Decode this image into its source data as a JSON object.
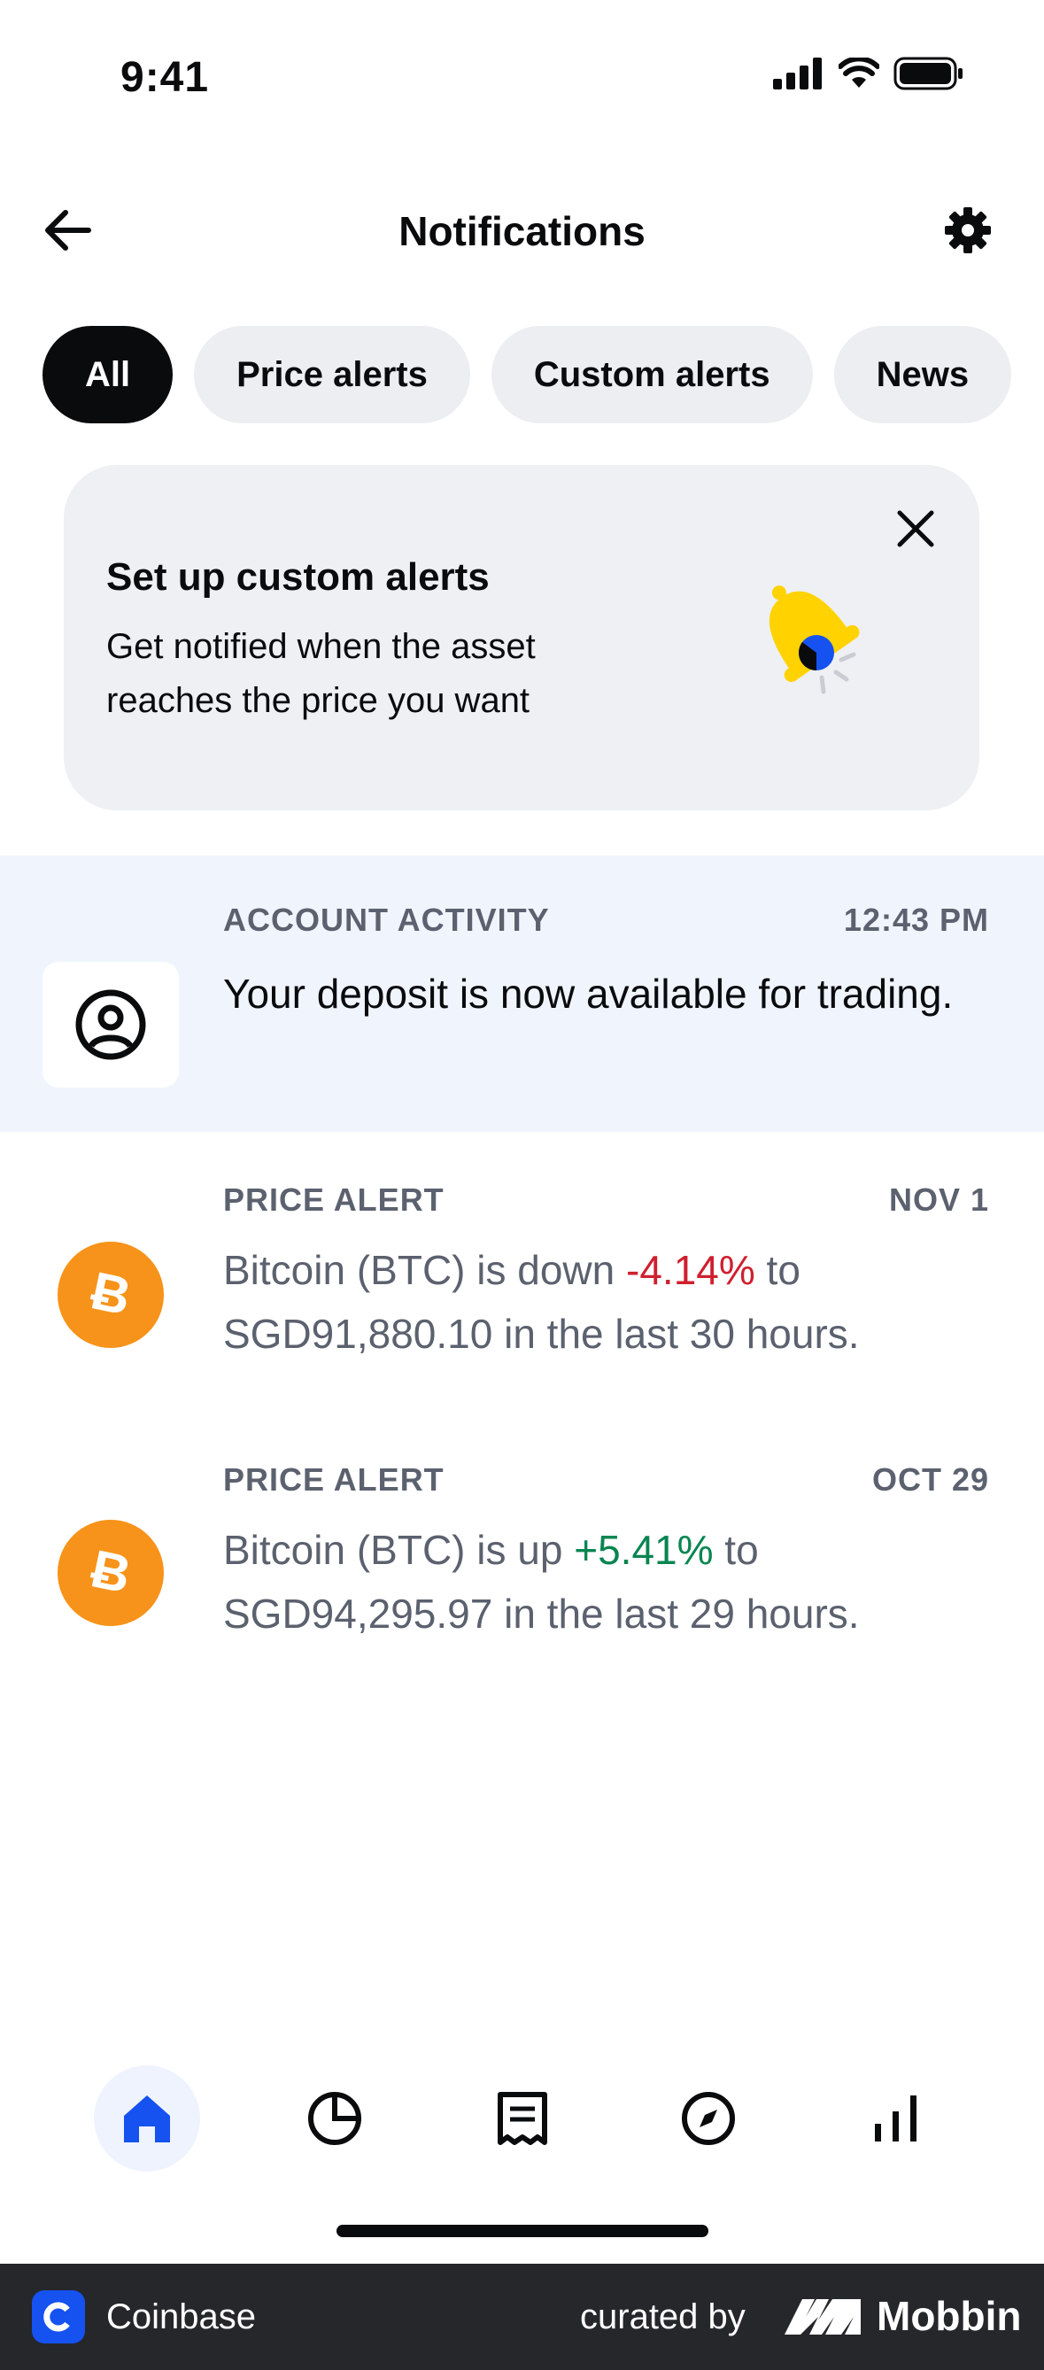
{
  "status_bar": {
    "time": "9:41"
  },
  "header": {
    "title": "Notifications"
  },
  "filters": [
    {
      "label": "All",
      "active": true
    },
    {
      "label": "Price alerts",
      "active": false
    },
    {
      "label": "Custom alerts",
      "active": false
    },
    {
      "label": "News",
      "active": false
    }
  ],
  "promo": {
    "title": "Set up custom alerts",
    "body": "Get notified when the asset reaches the price you want"
  },
  "notifications": [
    {
      "category": "ACCOUNT ACTIVITY",
      "time": "12:43 PM",
      "message": "Your deposit is now available for trading.",
      "icon": "user-circle-icon"
    },
    {
      "category": "PRICE ALERT",
      "time": "NOV 1",
      "message_pre": "Bitcoin (BTC) is down ",
      "change": "-4.14%",
      "message_post": " to SGD91,880.10 in the last 30 hours.",
      "icon": "bitcoin-icon"
    },
    {
      "category": "PRICE ALERT",
      "time": "OCT 29",
      "message_pre": "Bitcoin (BTC) is up ",
      "change": "+5.41%",
      "message_post": " to SGD94,295.97 in the last 29 hours.",
      "icon": "bitcoin-icon"
    }
  ],
  "bottom_nav": [
    {
      "name": "home",
      "icon": "home-icon",
      "active": true
    },
    {
      "name": "portfolio",
      "icon": "pie-chart-icon",
      "active": false
    },
    {
      "name": "transactions",
      "icon": "receipt-icon",
      "active": false
    },
    {
      "name": "explore",
      "icon": "compass-icon",
      "active": false
    },
    {
      "name": "trade",
      "icon": "bar-chart-icon",
      "active": false
    }
  ],
  "footer": {
    "app_name": "Coinbase",
    "curated_by": "curated by",
    "brand": "Mobbin"
  },
  "colors": {
    "accent": "#1652f0",
    "negative": "#cf202f",
    "positive": "#098551",
    "bitcoin": "#f7931a",
    "bell": "#ffd200"
  }
}
